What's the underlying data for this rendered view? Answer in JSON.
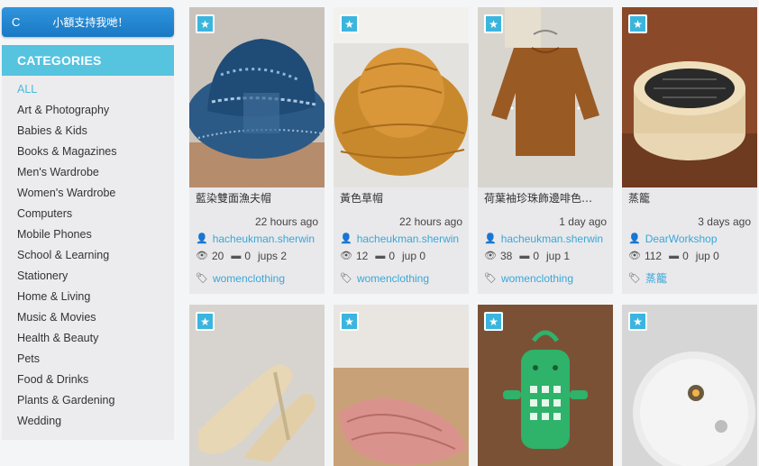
{
  "support_button": {
    "prefix": "C",
    "label": "小額支持我哋！"
  },
  "sidebar": {
    "heading": "CATEGORIES",
    "items": [
      {
        "label": "ALL",
        "active": true
      },
      {
        "label": "Art & Photography"
      },
      {
        "label": "Babies & Kids"
      },
      {
        "label": "Books & Magazines"
      },
      {
        "label": "Men's Wardrobe"
      },
      {
        "label": "Women's Wardrobe"
      },
      {
        "label": "Computers"
      },
      {
        "label": "Mobile Phones"
      },
      {
        "label": "School & Learning"
      },
      {
        "label": "Stationery"
      },
      {
        "label": "Home & Living"
      },
      {
        "label": "Music & Movies"
      },
      {
        "label": "Health & Beauty"
      },
      {
        "label": "Pets"
      },
      {
        "label": "Food & Drinks"
      },
      {
        "label": "Plants & Gardening"
      },
      {
        "label": "Wedding"
      }
    ]
  },
  "listings": [
    {
      "title": "藍染雙面漁夫帽",
      "time": "22 hours ago",
      "user": "hacheukman.sherwin",
      "views": "20",
      "comments": "0",
      "jups": "jups 2",
      "tag": "womenclothing"
    },
    {
      "title": "黃色草帽",
      "time": "22 hours ago",
      "user": "hacheukman.sherwin",
      "views": "12",
      "comments": "0",
      "jups": "jup 0",
      "tag": "womenclothing"
    },
    {
      "title": "荷葉袖珍珠飾邊啡色…",
      "time": "1 day ago",
      "user": "hacheukman.sherwin",
      "views": "38",
      "comments": "0",
      "jups": "jup 1",
      "tag": "womenclothing"
    },
    {
      "title": "蒸籠",
      "time": "3 days ago",
      "user": "DearWorkshop",
      "views": "112",
      "comments": "0",
      "jups": "jup 0",
      "tag": "蒸籠"
    }
  ],
  "icons": {
    "star": "star-icon",
    "user": "user-icon",
    "eye": "eye-icon",
    "comment": "comment-icon",
    "tag": "tag-icon"
  },
  "colors": {
    "accent": "#3cb5de",
    "category_header": "#56c3df",
    "support_button": "#1f84cc",
    "link": "#3aa6d8"
  }
}
